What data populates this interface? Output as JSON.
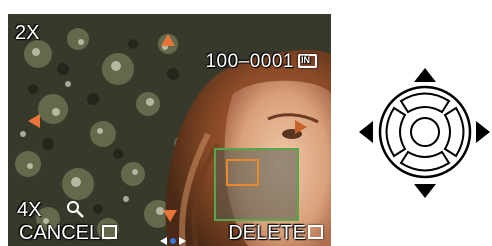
{
  "lcd": {
    "zoom_level": "2X",
    "file_number": "100–0001",
    "file_badge": "IN",
    "zoom_step": "4X",
    "cancel_label": "CANCEL",
    "delete_label": "DELETE",
    "icons": {
      "magnifier": "magnifier-icon",
      "cancel_button_icon": "display-button-icon",
      "delete_button_icon": "trash-icon",
      "pan_arrows": "orange-triangle-icon",
      "playback": "play-indicator-icon"
    },
    "colors": {
      "osd_text": "#ffffff",
      "pan_arrow": "#e8743a",
      "navigator_border": "#54a849",
      "navigator_frame": "#e88a2c"
    }
  },
  "cursor_pad": {
    "icon": "cursor-key-pad-icon",
    "buttons": [
      "up",
      "down",
      "left",
      "right",
      "menu-set"
    ]
  }
}
